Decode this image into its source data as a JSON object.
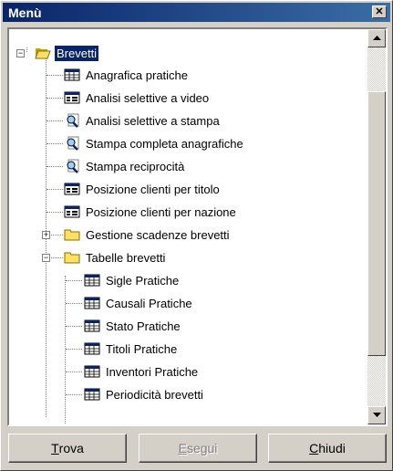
{
  "window": {
    "title": "Menù",
    "close_glyph": "✕"
  },
  "tree": {
    "root": {
      "label": "Brevetti",
      "expanded": true,
      "icon": "folder-open-icon"
    },
    "items": [
      {
        "label": "Anagrafica pratiche",
        "icon": "table-icon"
      },
      {
        "label": "Analisi selettive a video",
        "icon": "form-icon"
      },
      {
        "label": "Analisi selettive a stampa",
        "icon": "print-preview-icon"
      },
      {
        "label": "Stampa completa anagrafiche",
        "icon": "print-preview-icon"
      },
      {
        "label": "Stampa reciprocità",
        "icon": "print-preview-icon"
      },
      {
        "label": "Posizione clienti per titolo",
        "icon": "form-icon"
      },
      {
        "label": "Posizione clienti per nazione",
        "icon": "form-icon"
      },
      {
        "label": "Gestione scadenze brevetti",
        "icon": "folder-icon",
        "expanded": false
      },
      {
        "label": "Tabelle brevetti",
        "icon": "folder-icon",
        "expanded": true
      }
    ],
    "subitems": [
      {
        "label": "Sigle Pratiche",
        "icon": "table-icon"
      },
      {
        "label": "Causali Pratiche",
        "icon": "table-icon"
      },
      {
        "label": "Stato Pratiche",
        "icon": "table-icon"
      },
      {
        "label": "Titoli Pratiche",
        "icon": "table-icon"
      },
      {
        "label": "Inventori Pratiche",
        "icon": "table-icon"
      },
      {
        "label": "Periodicità brevetti",
        "icon": "table-icon"
      }
    ]
  },
  "buttons": {
    "find": {
      "key": "T",
      "rest": "rova"
    },
    "run": {
      "key": "E",
      "rest": "segui",
      "disabled": true
    },
    "close": {
      "key": "C",
      "rest": "hiudi"
    }
  },
  "colors": {
    "titlebar": "#0a246a",
    "selection": "#0a246a",
    "face": "#d4d0c8"
  }
}
